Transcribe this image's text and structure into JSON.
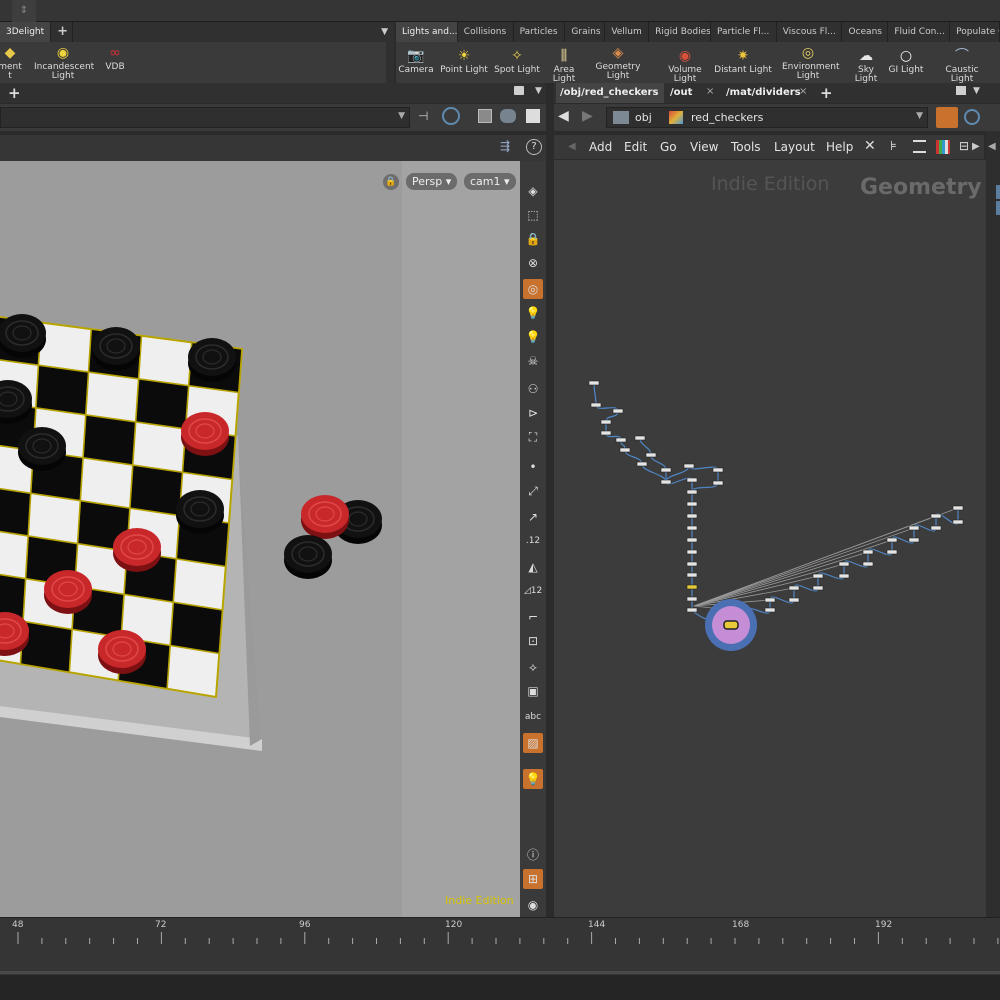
{
  "shelf_left": {
    "tab": "3Delight",
    "tools": [
      {
        "label": "ment",
        "label2": "t",
        "icon": "light-icon"
      },
      {
        "label": "Incandescent",
        "label2": "Light",
        "icon": "incandescent-light-icon"
      },
      {
        "label": "VDB",
        "label2": "",
        "icon": "vdb-icon"
      }
    ]
  },
  "shelf_right": {
    "tabs": [
      "Lights and...",
      "Collisions",
      "Particles",
      "Grains",
      "Vellum",
      "Rigid Bodies",
      "Particle Fl...",
      "Viscous Fl...",
      "Oceans",
      "Fluid Con...",
      "Populate Co"
    ],
    "tools": [
      {
        "label": "Camera",
        "label2": ""
      },
      {
        "label": "Point Light",
        "label2": ""
      },
      {
        "label": "Spot Light",
        "label2": ""
      },
      {
        "label": "Area Light",
        "label2": ""
      },
      {
        "label": "Geometry",
        "label2": "Light"
      },
      {
        "label": "Volume Light",
        "label2": ""
      },
      {
        "label": "Distant Light",
        "label2": ""
      },
      {
        "label": "Environment",
        "label2": "Light"
      },
      {
        "label": "Sky Light",
        "label2": ""
      },
      {
        "label": "GI Light",
        "label2": ""
      },
      {
        "label": "Caustic Light",
        "label2": ""
      }
    ]
  },
  "viewport": {
    "view_mode": "Persp",
    "camera": "cam1",
    "watermark": "Indie Edition"
  },
  "network": {
    "tabs": [
      "/obj/red_checkers",
      "/out",
      "/mat/dividers"
    ],
    "path": [
      "obj",
      "red_checkers"
    ],
    "menu": [
      "Add",
      "Edit",
      "Go",
      "View",
      "Tools",
      "Layout",
      "Help"
    ],
    "watermark": "Indie Edition",
    "context": "Geometry"
  },
  "timeline": {
    "ticks": [
      "48",
      "72",
      "96",
      "120",
      "144",
      "168",
      "192"
    ]
  }
}
